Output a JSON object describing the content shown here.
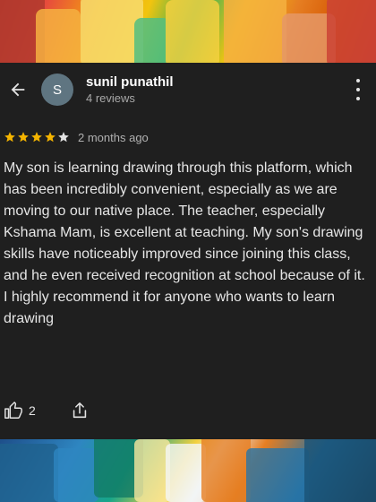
{
  "reviewer": {
    "initial": "S",
    "name": "sunil punathil",
    "reviews_count": "4 reviews",
    "avatar_color": "#5f7581"
  },
  "rating": {
    "stars": 4,
    "max": 5,
    "star_color": "#f4b400",
    "date": "2 months ago"
  },
  "review_text": "My son is learning drawing through this platform, which has been incredibly convenient, especially as we are moving to our native place. The teacher, especially Kshama Mam, is excellent at teaching. My son's drawing skills have noticeably improved since joining this class, and he even received recognition at school because of it. I highly recommend it for anyone who wants to learn drawing",
  "actions": {
    "like_count": "2",
    "like_icon": "thumbs-up-icon",
    "share_icon": "share-icon"
  },
  "header": {
    "back_icon": "arrow-left-icon",
    "more_icon": "more-vert-icon"
  }
}
